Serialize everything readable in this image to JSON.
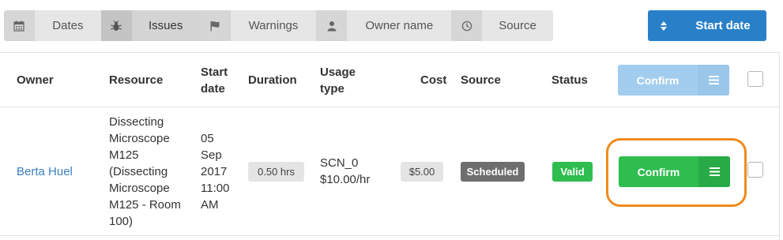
{
  "filter_bar": {
    "items": [
      {
        "icon": "calendar-icon",
        "label": "Dates",
        "active": false
      },
      {
        "icon": "bug-icon",
        "label": "Issues",
        "active": true
      },
      {
        "icon": "flag-icon",
        "label": "Warnings",
        "active": false
      },
      {
        "icon": "user-icon",
        "label": "Owner name",
        "active": false
      },
      {
        "icon": "clock-icon",
        "label": "Source",
        "active": false
      }
    ]
  },
  "sort_button": {
    "icon": "sort-icon",
    "label": "Start date",
    "color": "#2980c9"
  },
  "table": {
    "headers": {
      "owner": "Owner",
      "resource": "Resource",
      "start_date_1": "Start",
      "start_date_2": "date",
      "duration": "Duration",
      "usage_type_1": "Usage",
      "usage_type_2": "type",
      "cost": "Cost",
      "source": "Source",
      "status": "Status",
      "confirm": "Confirm"
    },
    "rows": [
      {
        "owner": "Berta Huel",
        "resource_lines": [
          "Dissecting",
          "Microscope",
          "M125",
          "(Dissecting",
          "Microscope",
          "M125 - Room",
          "100)"
        ],
        "start_lines": [
          "05",
          "Sep",
          "2017",
          "11:00",
          "AM"
        ],
        "duration": "0.50 hrs",
        "usage_line1": "SCN_0",
        "usage_line2": "$10.00/hr",
        "cost": "$5.00",
        "source": "Scheduled",
        "status": "Valid",
        "confirm": "Confirm"
      }
    ]
  },
  "colors": {
    "confirm_green": "#2fbd4f",
    "confirm_header_disabled": "#a3cdef",
    "highlight": "#f08a1c",
    "link": "#3a7fc1"
  }
}
